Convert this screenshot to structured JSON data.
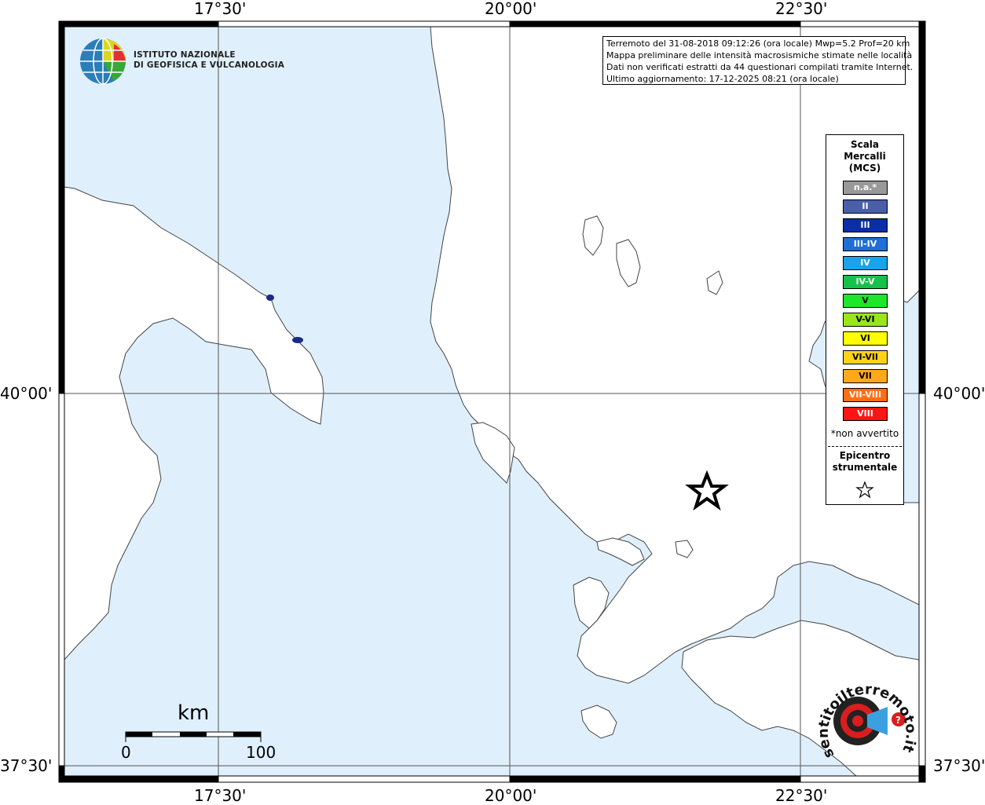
{
  "institute": {
    "line1": "ISTITUTO NAZIONALE",
    "line2": "DI GEOFISICA E VULCANOLOGIA"
  },
  "info": {
    "line1": "Terremoto del 31-08-2018 09:12:26 (ora locale) Mwp=5.2 Prof=20 km",
    "line2": "Mappa preliminare delle intensità macrosismiche stimate nelle località",
    "line3": "Dati non verificati estratti da 44 questionari compilati tramite Internet.",
    "line4": "Ultimo aggiornamento: 17-12-2025 08:21 (ora locale)"
  },
  "coordinates": {
    "lon_left": "17°30'",
    "lon_mid": "20°00'",
    "lon_right": "22°30'",
    "lat_mid": "40°00'",
    "lat_bottom": "37°30'"
  },
  "legend": {
    "title1": "Scala",
    "title2": "Mercalli",
    "title3": "(MCS)",
    "items": [
      {
        "label": "n.a.*",
        "color": "#999999"
      },
      {
        "label": "II",
        "color": "#4a5fa8"
      },
      {
        "label": "III",
        "color": "#0a2ea8"
      },
      {
        "label": "III-IV",
        "color": "#1f6fd6"
      },
      {
        "label": "IV",
        "color": "#1aa3e8"
      },
      {
        "label": "IV-V",
        "color": "#14c24a"
      },
      {
        "label": "V",
        "color": "#1ee62a"
      },
      {
        "label": "V-VI",
        "color": "#9ae61a"
      },
      {
        "label": "VI",
        "color": "#ffff00"
      },
      {
        "label": "VI-VII",
        "color": "#ffd21a"
      },
      {
        "label": "VII",
        "color": "#ffa81a"
      },
      {
        "label": "VII-VIII",
        "color": "#ff6e14"
      },
      {
        "label": "VIII",
        "color": "#ff1414"
      }
    ],
    "note": "*non avvertito",
    "epicenter1": "Epicentro",
    "epicenter2": "strumentale"
  },
  "scale_bar": {
    "unit": "km",
    "min": "0",
    "max": "100"
  },
  "colors": {
    "sea": "#dff0fc",
    "land": "#ffffff",
    "grid": "#555555"
  },
  "watermark": {
    "text": "sentitoilterremoto.it"
  }
}
